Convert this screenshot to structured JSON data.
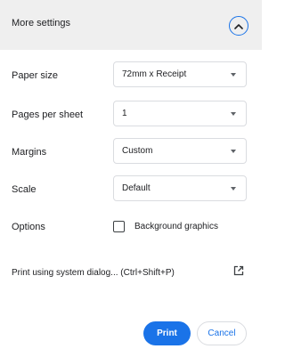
{
  "header": {
    "title": "More settings",
    "collapse_icon": "chevron-up-icon"
  },
  "settings": {
    "paper_size": {
      "label": "Paper size",
      "value": "72mm x Receipt"
    },
    "pages_per_sheet": {
      "label": "Pages per sheet",
      "value": "1"
    },
    "margins": {
      "label": "Margins",
      "value": "Custom"
    },
    "scale": {
      "label": "Scale",
      "value": "Default"
    },
    "options": {
      "label": "Options",
      "checkbox_label": "Background graphics",
      "checked": false
    }
  },
  "system_dialog": {
    "label": "Print using system dialog... (Ctrl+Shift+P)",
    "icon": "open-in-new-icon"
  },
  "actions": {
    "print_label": "Print",
    "cancel_label": "Cancel"
  },
  "colors": {
    "accent": "#1a73e8",
    "header_bg": "#efefef",
    "border": "#dadce0"
  }
}
